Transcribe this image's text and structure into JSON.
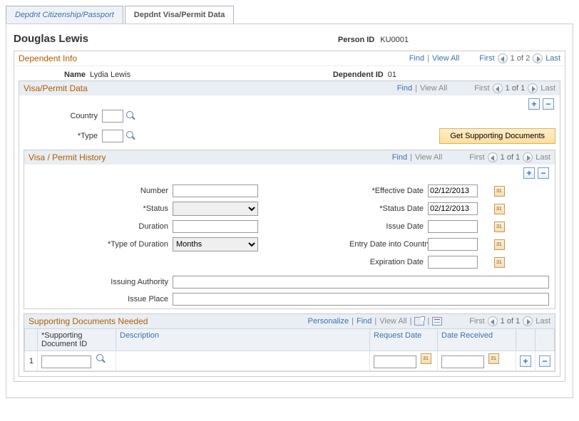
{
  "tabs": {
    "citizenship": "Depdnt Citizenship/Passport",
    "visa": "Depdnt Visa/Permit Data"
  },
  "header": {
    "person_name": "Douglas Lewis",
    "person_id_label": "Person ID",
    "person_id": "KU0001"
  },
  "dependent_info": {
    "title": "Dependent Info",
    "nav": {
      "find": "Find",
      "view_all": "View All",
      "first": "First",
      "pos": "1 of 2",
      "last": "Last"
    },
    "name_label": "Name",
    "name_value": "Lydia Lewis",
    "dep_id_label": "Dependent ID",
    "dep_id_value": "01"
  },
  "visa_permit": {
    "title": "Visa/Permit Data",
    "nav": {
      "find": "Find",
      "view_all": "View All",
      "first": "First",
      "pos": "1 of 1",
      "last": "Last"
    },
    "country_label": "Country",
    "country_value": "",
    "type_label": "Type",
    "type_value": "",
    "get_docs_btn": "Get Supporting Documents"
  },
  "history": {
    "title": "Visa / Permit History",
    "nav": {
      "find": "Find",
      "view_all": "View All",
      "first": "First",
      "pos": "1 of 1",
      "last": "Last"
    },
    "number_label": "Number",
    "number_value": "",
    "status_label": "Status",
    "status_value": "",
    "duration_label": "Duration",
    "duration_value": "",
    "type_dur_label": "Type of Duration",
    "type_dur_value": "Months",
    "eff_date_label": "Effective Date",
    "eff_date_value": "02/12/2013",
    "status_date_label": "Status Date",
    "status_date_value": "02/12/2013",
    "issue_date_label": "Issue Date",
    "issue_date_value": "",
    "entry_date_label": "Entry Date into Country",
    "entry_date_value": "",
    "exp_date_label": "Expiration Date",
    "exp_date_value": "",
    "issuing_auth_label": "Issuing Authority",
    "issuing_auth_value": "",
    "issue_place_label": "Issue Place",
    "issue_place_value": ""
  },
  "supporting": {
    "title": "Supporting Documents Needed",
    "nav": {
      "personalize": "Personalize",
      "find": "Find",
      "view_all": "View All",
      "first": "First",
      "pos": "1 of 1",
      "last": "Last"
    },
    "cols": {
      "doc_id": "*Supporting Document ID",
      "desc": "Description",
      "req_date": "Request Date",
      "date_recv": "Date Received"
    },
    "rows": [
      {
        "n": "1",
        "doc_id": "",
        "desc": "",
        "req_date": "",
        "date_recv": ""
      }
    ]
  }
}
